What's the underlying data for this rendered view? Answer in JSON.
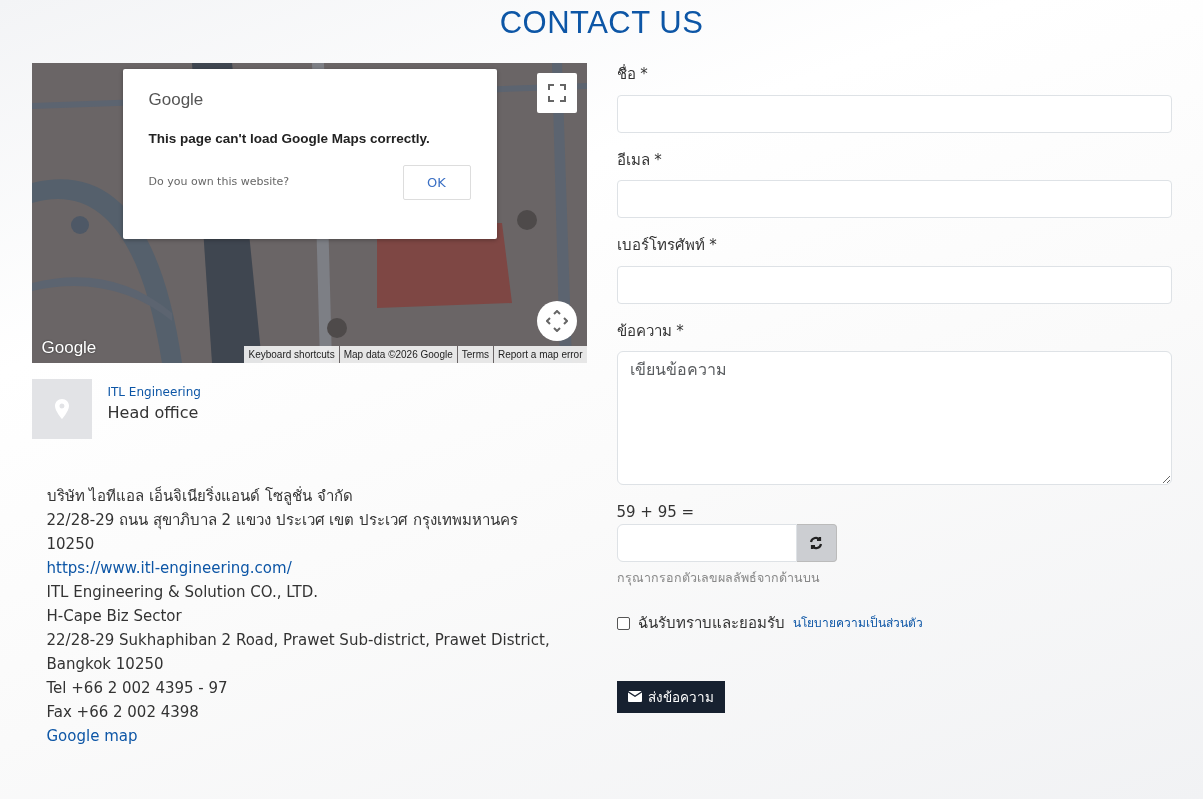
{
  "page": {
    "title": "CONTACT US"
  },
  "map": {
    "kind": "picture",
    "logo": "Google",
    "dialog": {
      "brand": "Google",
      "message": "This page can't load Google Maps correctly.",
      "question": "Do you own this website?",
      "button": "OK"
    },
    "attribution": [
      "Keyboard shortcuts",
      "Map data ©2026 Google",
      "Terms",
      "Report a map error"
    ]
  },
  "location": {
    "company": "ITL Engineering",
    "label": "Head office"
  },
  "address": [
    {
      "kind": "text",
      "text": "บริษัท ไอทีแอล เอ็นจิเนียริ่งแอนด์ โซลูชั่น จำกัด"
    },
    {
      "kind": "text",
      "text": "22/28-29 ถนน สุขาภิบาล 2 แขวง ประเวศ เขต ประเวศ กรุงเทพมหานคร 10250"
    },
    {
      "kind": "link",
      "text": "https://www.itl-engineering.com/"
    },
    {
      "kind": "text",
      "text": "ITL Engineering & Solution CO., LTD."
    },
    {
      "kind": "text",
      "text": "H-Cape Biz Sector"
    },
    {
      "kind": "text",
      "text": "22/28-29 Sukhaphiban 2 Road, Prawet Sub-district, Prawet District, Bangkok 10250"
    },
    {
      "kind": "text",
      "text": "Tel +66 2 002 4395 - 97"
    },
    {
      "kind": "text",
      "text": "Fax +66 2 002 4398"
    },
    {
      "kind": "link",
      "text": "Google map"
    }
  ],
  "form": {
    "fields": [
      {
        "kind": "input",
        "label": "ชื่อ *"
      },
      {
        "kind": "input",
        "label": "อีเมล *"
      },
      {
        "kind": "input",
        "label": "เบอร์โทรศัพท์ *"
      },
      {
        "kind": "textarea",
        "label": "ข้อความ *",
        "placeholder": "เขียนข้อความ"
      }
    ],
    "captcha": {
      "question": "59 + 95 =",
      "hint": "กรุณากรอกตัวเลขผลลัพธ์จากด้านบน"
    },
    "consent": {
      "checked": false,
      "text": "ฉันรับทราบและยอมรับ",
      "link": "นโยบายความเป็นส่วนตัว"
    },
    "submit": "ส่งข้อความ"
  }
}
